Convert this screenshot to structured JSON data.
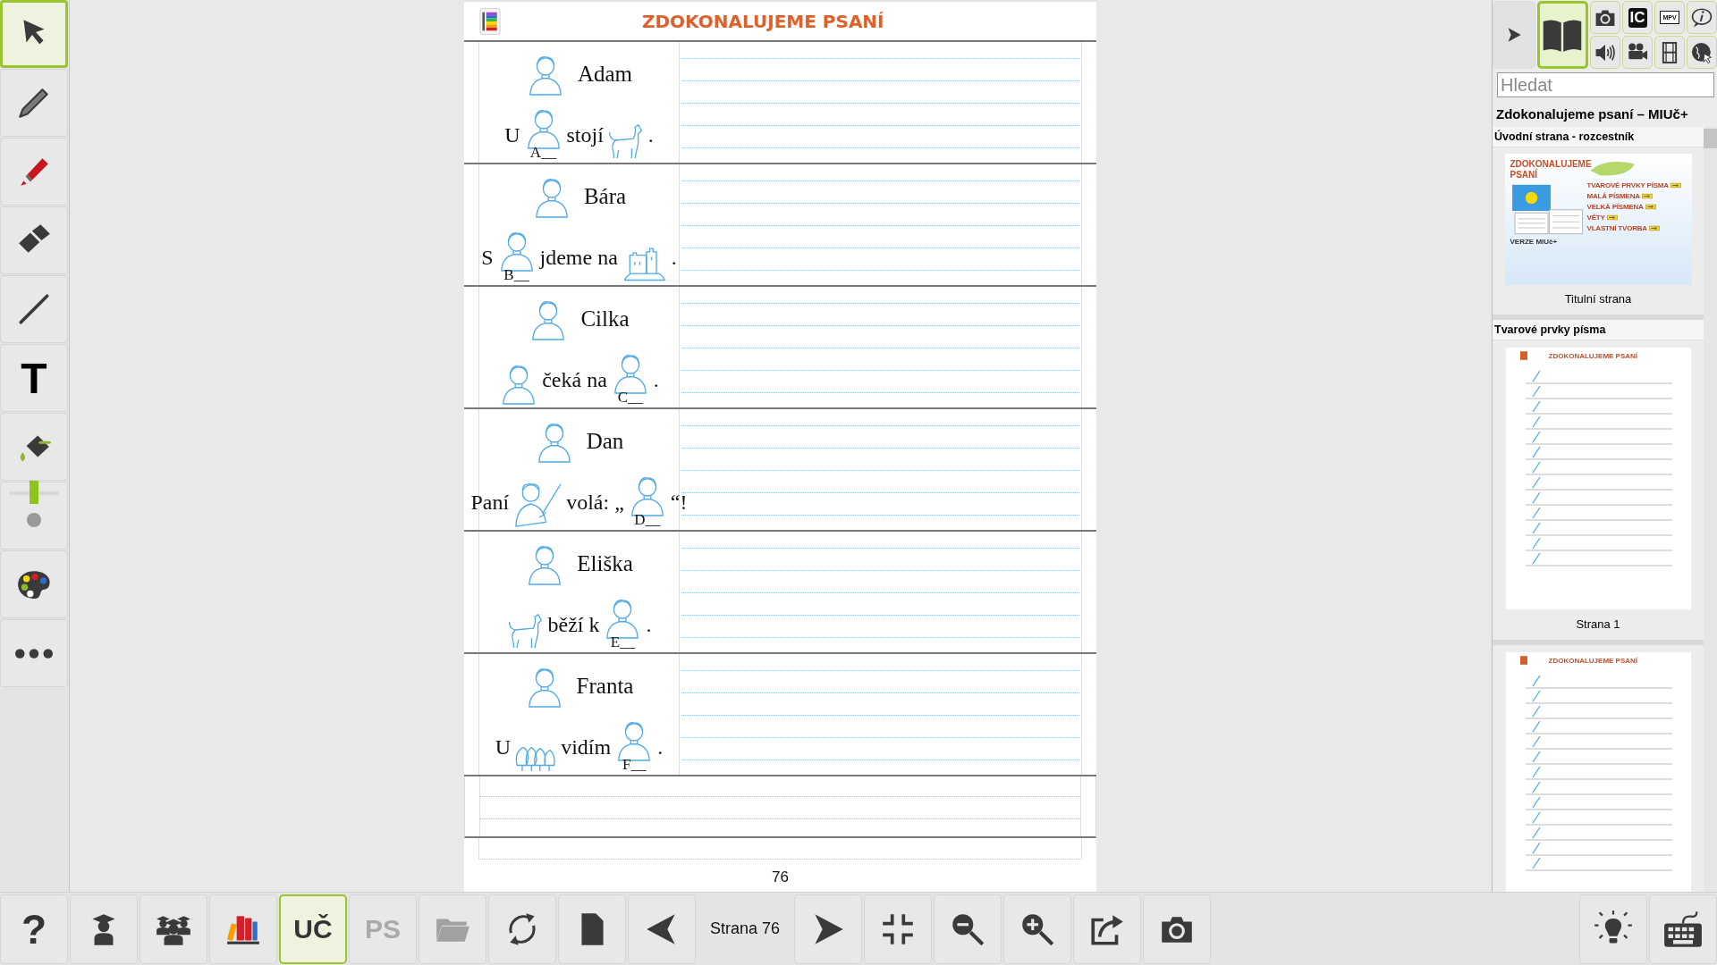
{
  "tools": [
    {
      "kind": "select",
      "selected": true
    },
    {
      "kind": "pencil",
      "selected": false
    },
    {
      "kind": "marker",
      "selected": false
    },
    {
      "kind": "eraser",
      "selected": false
    },
    {
      "kind": "line",
      "selected": false
    },
    {
      "kind": "text",
      "label": "T",
      "selected": false
    },
    {
      "kind": "fill",
      "selected": false
    },
    {
      "kind": "size",
      "level": 0.5,
      "selected": false
    },
    {
      "kind": "palette",
      "selected": false
    },
    {
      "kind": "more",
      "selected": false
    }
  ],
  "sheet": {
    "title": "ZDOKONALUJEME PSANÍ",
    "entries": [
      {
        "name": "Adam",
        "sentence": [
          {
            "kind": "word",
            "text": "U"
          },
          {
            "kind": "person",
            "caption": "A__"
          },
          {
            "kind": "word",
            "text": "stojí"
          },
          {
            "kind": "animal"
          },
          {
            "kind": "word",
            "text": "."
          }
        ]
      },
      {
        "name": "Bára",
        "sentence": [
          {
            "kind": "word",
            "text": "S"
          },
          {
            "kind": "person",
            "caption": "B__"
          },
          {
            "kind": "word",
            "text": "jdeme na"
          },
          {
            "kind": "castle"
          },
          {
            "kind": "word",
            "text": "."
          }
        ]
      },
      {
        "name": "Cilka",
        "sentence": [
          {
            "kind": "person"
          },
          {
            "kind": "word",
            "text": "čeká na"
          },
          {
            "kind": "person",
            "caption": "C__"
          },
          {
            "kind": "word",
            "text": "."
          }
        ]
      },
      {
        "name": "Dan",
        "sentence": [
          {
            "kind": "word",
            "text": "Paní"
          },
          {
            "kind": "teacher"
          },
          {
            "kind": "word",
            "text": "volá: „"
          },
          {
            "kind": "person",
            "caption": "D__"
          },
          {
            "kind": "word",
            "text": "“!"
          }
        ]
      },
      {
        "name": "Eliška",
        "sentence": [
          {
            "kind": "animal"
          },
          {
            "kind": "word",
            "text": "běží k"
          },
          {
            "kind": "person",
            "caption": "E__"
          },
          {
            "kind": "word",
            "text": "."
          }
        ]
      },
      {
        "name": "Franta",
        "sentence": [
          {
            "kind": "word",
            "text": "U"
          },
          {
            "kind": "trees"
          },
          {
            "kind": "word",
            "text": "vidím"
          },
          {
            "kind": "person",
            "caption": "F__"
          },
          {
            "kind": "word",
            "text": "."
          }
        ]
      }
    ],
    "page_number": "76"
  },
  "panel": {
    "tools": [
      {
        "kind": "collapse"
      },
      {
        "kind": "book",
        "selected": true
      },
      {
        "kind": "camera",
        "selected": false
      },
      {
        "kind": "badge_dark",
        "label": "IC",
        "selected": false
      },
      {
        "kind": "badge_light",
        "label": "MPV",
        "selected": false
      },
      {
        "kind": "info",
        "selected": false
      },
      {
        "kind": "speaker",
        "selected": false
      },
      {
        "kind": "video",
        "selected": false
      },
      {
        "kind": "film",
        "selected": false
      },
      {
        "kind": "globe",
        "selected": false
      }
    ],
    "search": {
      "placeholder": "Hledat"
    },
    "title": "Zdokonalujeme psaní – MIUč+",
    "sections": [
      {
        "title": "Úvodní strana - rozcestník",
        "pages": [
          {
            "kind": "cover",
            "heading": "ZDOKONALUJEME PSANÍ",
            "menu": [
              "TVAROVÉ PRVKY PÍSMA",
              "MALÁ PÍSMENA",
              "VELKÁ PÍSMENA",
              "VĚTY",
              "VLASTNÍ TVORBA"
            ],
            "badge": "VERZE MIUč+",
            "caption": "Titulní strana"
          }
        ]
      },
      {
        "title": "Tvarové prvky písma",
        "pages": [
          {
            "kind": "lines",
            "heading": "ZDOKONALUJEME PSANÍ",
            "caption": "Strana 1"
          },
          {
            "kind": "lines",
            "heading": "ZDOKONALUJEME PSANÍ"
          }
        ]
      }
    ]
  },
  "bottom_bar": {
    "left": [
      {
        "kind": "help",
        "label": "?",
        "selected": false,
        "disabled": false
      },
      {
        "kind": "student",
        "selected": false,
        "disabled": false
      },
      {
        "kind": "class",
        "selected": false,
        "disabled": false
      },
      {
        "kind": "library",
        "selected": false,
        "disabled": false
      },
      {
        "kind": "text",
        "label": "UČ",
        "selected": true,
        "disabled": false
      },
      {
        "kind": "text",
        "label": "PS",
        "selected": false,
        "disabled": true
      },
      {
        "kind": "folder",
        "selected": false,
        "disabled": true
      },
      {
        "kind": "sync",
        "selected": false,
        "disabled": false
      },
      {
        "kind": "page",
        "selected": false,
        "disabled": false
      },
      {
        "kind": "prev",
        "selected": false,
        "disabled": false
      },
      {
        "kind": "page_label",
        "label": "Strana 76"
      },
      {
        "kind": "next",
        "selected": false,
        "disabled": false
      },
      {
        "kind": "fit",
        "selected": false,
        "disabled": false
      },
      {
        "kind": "zoom_out",
        "selected": false,
        "disabled": false
      },
      {
        "kind": "zoom_in",
        "selected": false,
        "disabled": false
      },
      {
        "kind": "share",
        "selected": false,
        "disabled": false
      },
      {
        "kind": "camera",
        "selected": false,
        "disabled": false
      }
    ],
    "right": [
      {
        "kind": "light"
      },
      {
        "kind": "keyboard"
      }
    ]
  }
}
